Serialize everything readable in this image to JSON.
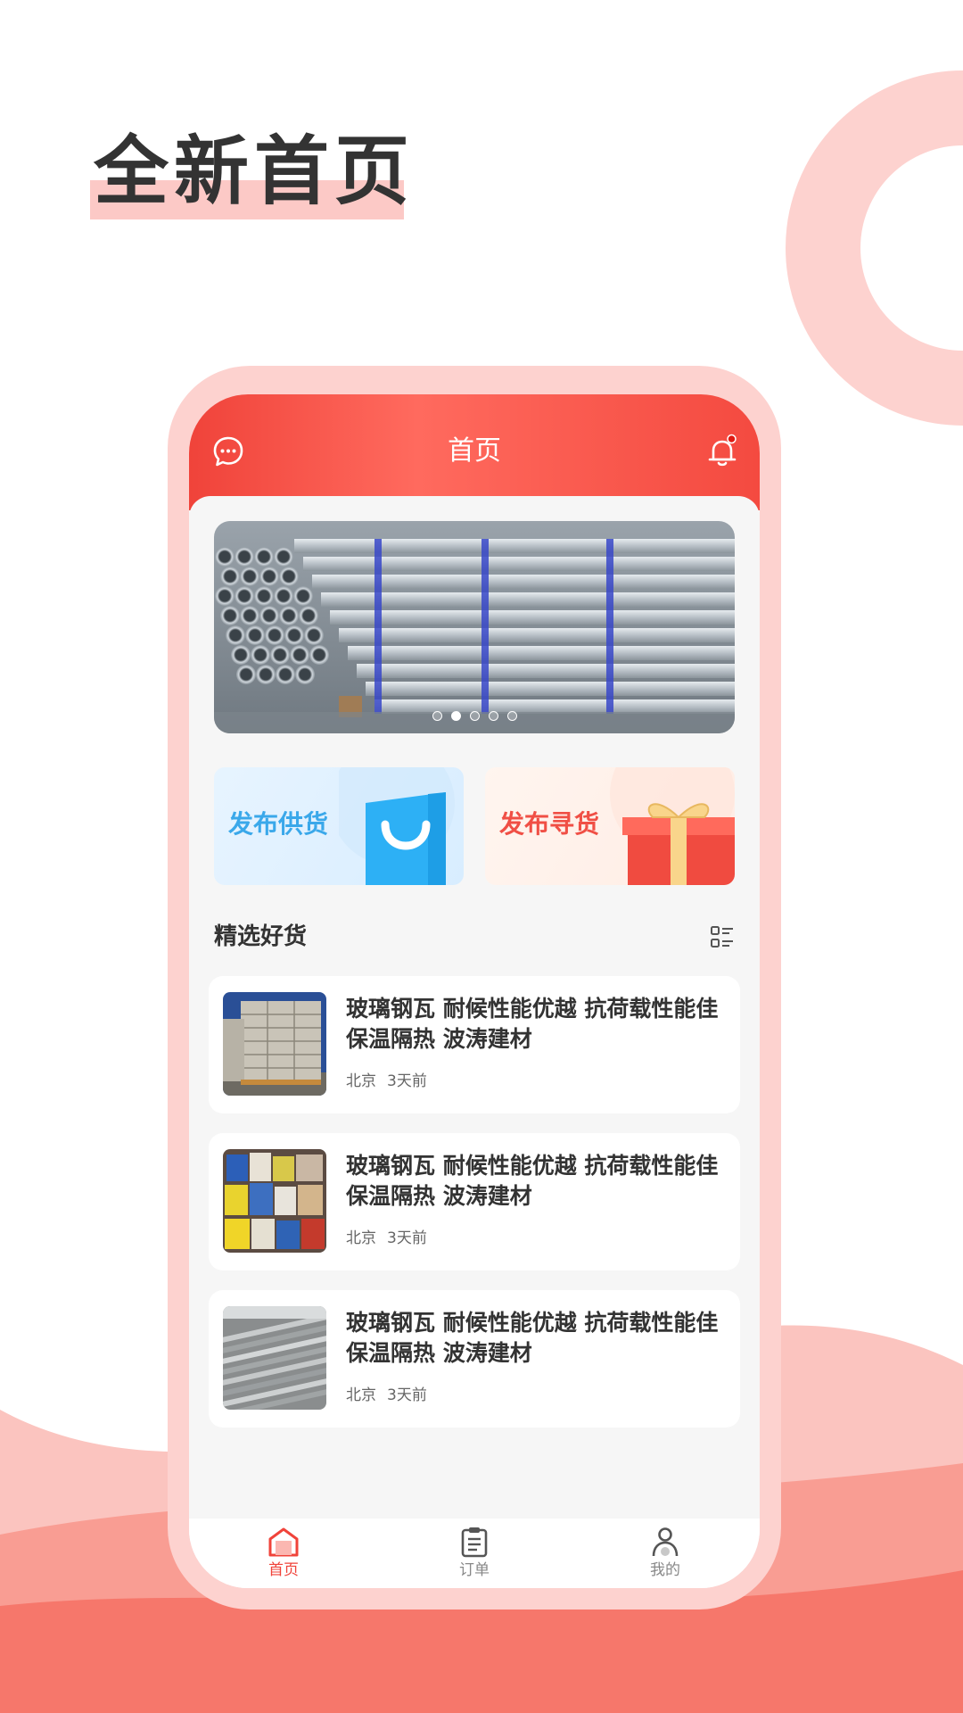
{
  "headline": "全新首页",
  "colors": {
    "brand": "#f0433a",
    "headline_highlight": "#fcc9c6",
    "decor": "#fdd2cf"
  },
  "nav": {
    "title": "首页",
    "left_icon": "chat-bubble-icon",
    "right_icon": "bell-icon"
  },
  "banner": {
    "image": "steel-pipes-photo",
    "dots_total": 5,
    "dots_active_index": 2
  },
  "actions": [
    {
      "label": "发布供货",
      "icon": "shopping-bag-icon"
    },
    {
      "label": "发布寻货",
      "icon": "gift-box-icon"
    }
  ],
  "section": {
    "title": "精选好货",
    "icon": "list-view-icon"
  },
  "items": [
    {
      "title": "玻璃钢瓦 耐候性能优越 抗荷载性能佳 保温隔热 波涛建材",
      "location": "北京",
      "time": "3天前",
      "image": "stacked-bricks-photo"
    },
    {
      "title": "玻璃钢瓦 耐候性能优越 抗荷载性能佳 保温隔热 波涛建材",
      "location": "北京",
      "time": "3天前",
      "image": "paint-buckets-photo"
    },
    {
      "title": "玻璃钢瓦 耐候性能优越 抗荷载性能佳 保温隔热 波涛建材",
      "location": "北京",
      "time": "3天前",
      "image": "steel-rods-photo"
    }
  ],
  "tabs": [
    {
      "label": "首页",
      "icon": "home-icon",
      "active": true
    },
    {
      "label": "订单",
      "icon": "clipboard-icon",
      "active": false
    },
    {
      "label": "我的",
      "icon": "user-icon",
      "active": false
    }
  ]
}
